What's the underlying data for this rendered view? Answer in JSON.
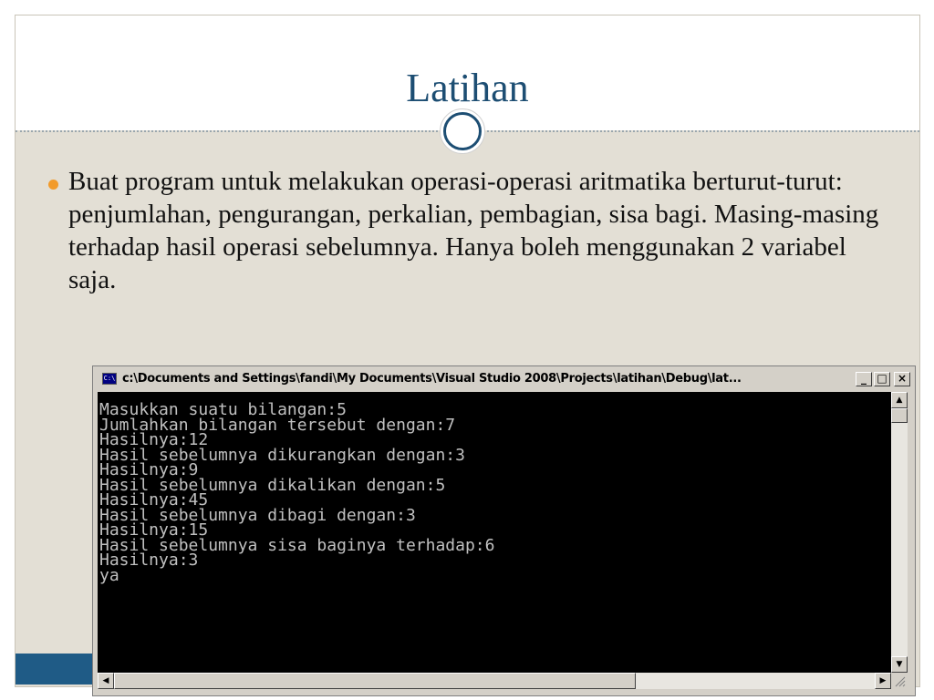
{
  "slide": {
    "title": "Latihan",
    "bullet": "Buat program untuk melakukan operasi-operasi aritmatika berturut-turut: penjumlahan, pengurangan, perkalian, pembagian, sisa bagi. Masing-masing terhadap hasil operasi sebelumnya. Hanya boleh menggunakan 2 variabel saja."
  },
  "console": {
    "icon_label": "C:\\",
    "title": "c:\\Documents and Settings\\fandi\\My Documents\\Visual Studio 2008\\Projects\\latihan\\Debug\\lat...",
    "minimize": "_",
    "maximize": "□",
    "close": "×",
    "lines": [
      "Masukkan suatu bilangan:5",
      "Jumlahkan bilangan tersebut dengan:7",
      "Hasilnya:12",
      "Hasil sebelumnya dikurangkan dengan:3",
      "Hasilnya:9",
      "Hasil sebelumnya dikalikan dengan:5",
      "Hasilnya:45",
      "Hasil sebelumnya dibagi dengan:3",
      "Hasilnya:15",
      "Hasil sebelumnya sisa baginya terhadap:6",
      "Hasilnya:3",
      "ya"
    ]
  },
  "colors": {
    "title": "#1d4e73",
    "bullet": "#f29b2b",
    "slide_bg": "#e3dfd5",
    "console_bg": "#000000",
    "console_text": "#c0c0c0"
  },
  "icons": {
    "console_icon": "command-prompt-icon",
    "scroll_up": "arrow-up-icon",
    "scroll_down": "arrow-down-icon",
    "scroll_left": "arrow-left-icon",
    "scroll_right": "arrow-right-icon"
  }
}
